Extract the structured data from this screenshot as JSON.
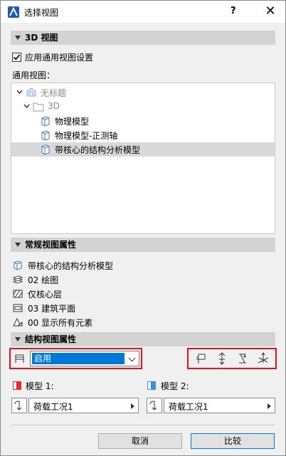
{
  "window": {
    "title": "选择视图",
    "help_label": "?",
    "close_label": "✕"
  },
  "sections": {
    "view3d": "3D 视图",
    "general_props": "常规视图属性",
    "structural_props": "结构视图属性"
  },
  "settings": {
    "use_generic_label": "应用通用视图设置",
    "use_generic_checked": true,
    "generic_views_label": "通用视图："
  },
  "tree": {
    "items": [
      {
        "label": "无标题",
        "level": 0,
        "expanded": true,
        "grayed": true
      },
      {
        "label": "3D",
        "level": 1,
        "expanded": true,
        "grayed": true
      },
      {
        "label": "物理模型",
        "level": 2,
        "selected": false
      },
      {
        "label": "物理模型-正测轴",
        "level": 2,
        "selected": false
      },
      {
        "label": "带核心的结构分析模型",
        "level": 2,
        "selected": true
      }
    ]
  },
  "general": {
    "view_name": "带核心的结构分析模型",
    "layer_combo": "02 绘图",
    "structural_function": "仅核心层",
    "partial_display": "03 建筑平面",
    "model_filter": "00 显示所有元素"
  },
  "structural": {
    "enable_value": "启用",
    "model1_label": "模型 1:",
    "model2_label": "模型 2:",
    "model1_case": "荷载工况1",
    "model2_case": "荷载工况1",
    "model1_color": "#e52b2b",
    "model2_color": "#3b8ee8"
  },
  "buttons": {
    "cancel": "取消",
    "compare": "比较"
  },
  "colors": {
    "highlight_border": "#e2141a",
    "selection_blue": "#0078d7"
  }
}
